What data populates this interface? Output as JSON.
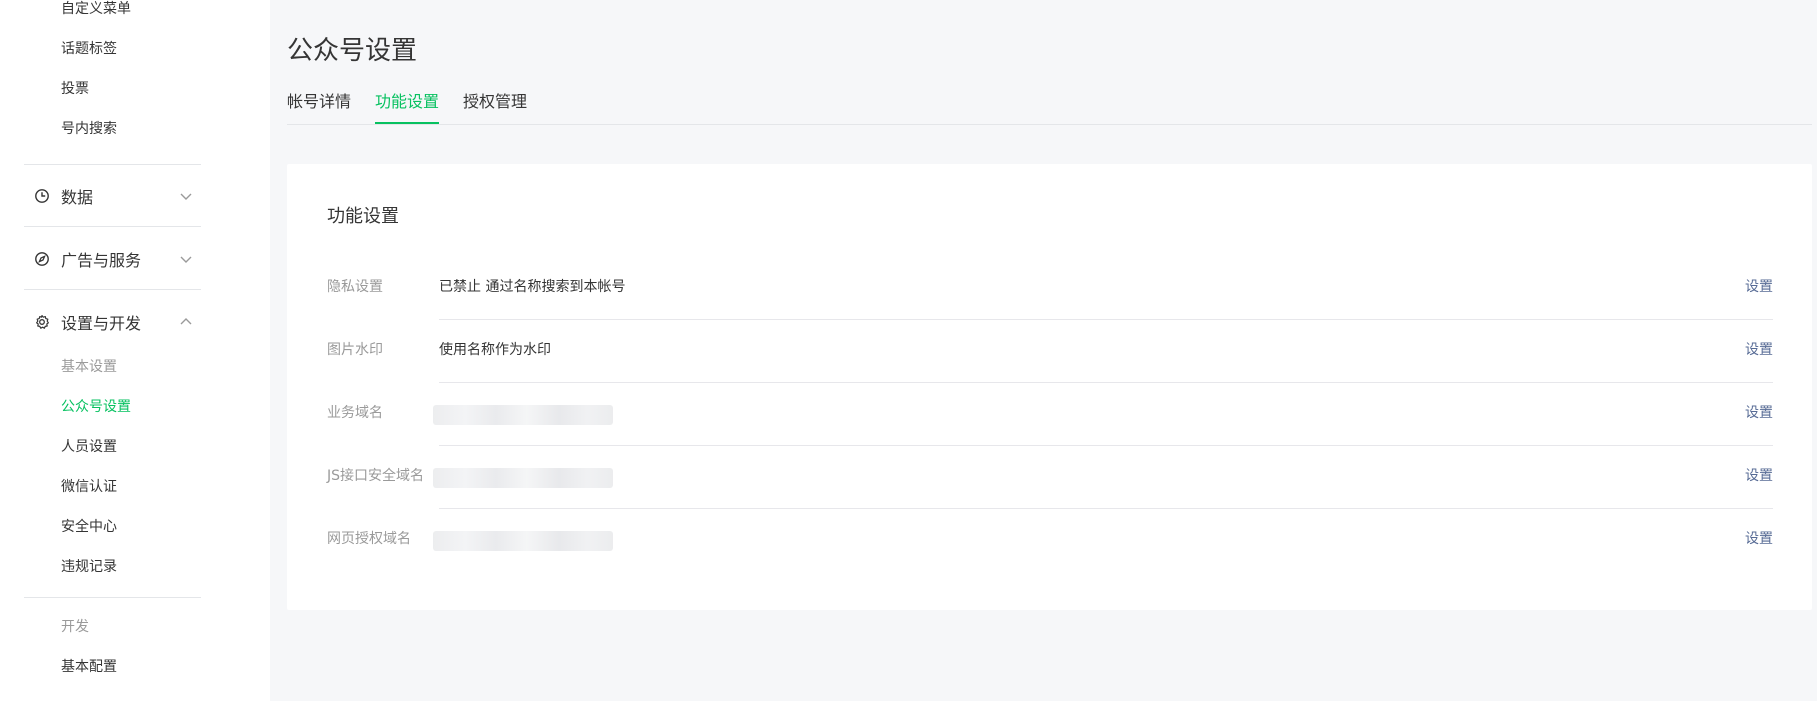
{
  "sidebar": {
    "top_items": [
      {
        "label": "自定义菜单"
      },
      {
        "label": "话题标签"
      },
      {
        "label": "投票"
      },
      {
        "label": "号内搜索"
      }
    ],
    "groups": [
      {
        "label": "数据",
        "icon": "clock-icon",
        "expanded": false
      },
      {
        "label": "广告与服务",
        "icon": "compass-icon",
        "expanded": false
      },
      {
        "label": "设置与开发",
        "icon": "gear-icon",
        "expanded": true
      }
    ],
    "settings_items": [
      {
        "label": "基本设置"
      },
      {
        "label": "公众号设置",
        "active": true
      },
      {
        "label": "人员设置"
      },
      {
        "label": "微信认证"
      },
      {
        "label": "安全中心"
      },
      {
        "label": "违规记录"
      }
    ],
    "dev_section_label": "开发",
    "dev_items": [
      {
        "label": "基本配置"
      }
    ]
  },
  "main": {
    "page_title": "公众号设置",
    "tabs": [
      {
        "label": "帐号详情",
        "active": false
      },
      {
        "label": "功能设置",
        "active": true
      },
      {
        "label": "授权管理",
        "active": false
      }
    ],
    "panel": {
      "title": "功能设置",
      "rows": [
        {
          "label": "隐私设置",
          "value": "已禁止 通过名称搜索到本帐号",
          "action": "设置"
        },
        {
          "label": "图片水印",
          "value": "使用名称作为水印",
          "action": "设置"
        },
        {
          "label": "业务域名",
          "value": "",
          "action": "设置"
        },
        {
          "label": "JS接口安全域名",
          "value": "",
          "action": "设置"
        },
        {
          "label": "网页授权域名",
          "value": "",
          "action": "设置"
        }
      ]
    }
  },
  "colors": {
    "accent": "#07c160",
    "link": "#576b95",
    "muted": "#9a9a9a",
    "text": "#353535",
    "page_bg": "#f6f7f9"
  }
}
